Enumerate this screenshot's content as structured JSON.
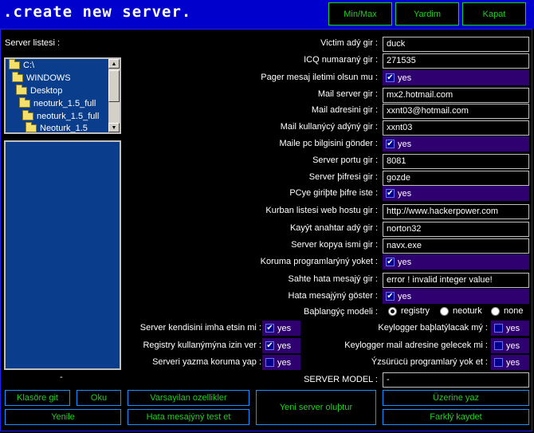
{
  "app": {
    "title": ".create new server."
  },
  "title_buttons": {
    "minmax": "Min/Max",
    "help": "Yardim",
    "close": "Kapat"
  },
  "server_list": {
    "label": "Server listesi :",
    "tree": [
      "C:\\",
      "WINDOWS",
      "Desktop",
      "neoturk_1.5_full",
      "neoturk_1.5_full",
      "Neoturk_1.5"
    ],
    "status": "-"
  },
  "form": {
    "victim_name": {
      "label": "Victim adý gir :",
      "value": "duck"
    },
    "icq_number": {
      "label": "ICQ numaraný gir :",
      "value": "271535"
    },
    "pager_message": {
      "label": "Pager mesaj iletimi olsun mu :",
      "option": "yes"
    },
    "mail_server": {
      "label": "Mail server gir :",
      "value": "mx2.hotmail.com"
    },
    "mail_address": {
      "label": "Mail adresini gir :",
      "value": "xxnt03@hotmail.com"
    },
    "mail_user": {
      "label": "Mail kullanýcý adýný gir :",
      "value": "xxnt03"
    },
    "mail_pc_info": {
      "label": "Maile pc bilgisini gönder :",
      "option": "yes"
    },
    "server_port": {
      "label": "Server portu gir :",
      "value": "8081"
    },
    "server_password": {
      "label": "Server þifresi gir :",
      "value": "gozde"
    },
    "pc_password": {
      "label": "PCye giriþte þifre iste :",
      "option": "yes"
    },
    "victim_list_host": {
      "label": "Kurban listesi web hostu gir  :",
      "value": "http://www.hackerpower.com"
    },
    "registry_key": {
      "label": "Kayýt anahtar adý gir :",
      "value": "norton32"
    },
    "server_copy": {
      "label": "Server kopya ismi gir :",
      "value": "navx.exe"
    },
    "kill_protection": {
      "label": "Koruma programlarýný yoket :",
      "option": "yes"
    },
    "fake_error": {
      "label": "Sahte hata mesajý gir :",
      "value": "error ! invalid integer value!"
    },
    "show_error": {
      "label": "Hata mesajýný göster :",
      "option": "yes"
    }
  },
  "startup_model": {
    "label": "Baþlangýç modeli :",
    "options": [
      "registry",
      "neoturk",
      "none"
    ],
    "selected": "registry"
  },
  "left_options": [
    {
      "label": "Server kendisini imha etsin mi :",
      "option": "yes",
      "checked": true
    },
    {
      "label": "Registry kullanýmýna izin ver :",
      "option": "yes",
      "checked": true
    },
    {
      "label": "Serveri yazma koruma yap :",
      "option": "yes",
      "checked": false
    }
  ],
  "right_options": [
    {
      "label": "Keylogger baþlatýlacak mý :",
      "option": "yes",
      "checked": false
    },
    {
      "label": "Keylogger mail adresine gelecek mi :",
      "option": "yes",
      "checked": false
    },
    {
      "label": "Ýzsürücü programlarý yok et :",
      "option": "yes",
      "checked": false
    }
  ],
  "server_model": {
    "label": "SERVER MODEL :",
    "value": "-"
  },
  "buttons": {
    "goto_folder": "Klasöre git",
    "read": "Oku",
    "default_settings": "Varsayilan ozellikler",
    "refresh": "Yenile",
    "test_error": "Hata mesajýný test et",
    "create_server": "Yeni server oluþtur",
    "overwrite": "Üzerine yaz",
    "save_as": "Farklý kaydet"
  },
  "colors": {
    "titlebar": "#0000cc",
    "accent_text": "#1fd01f",
    "checkbox_bg": "#2e0070",
    "panel": "#0a3d8c"
  }
}
